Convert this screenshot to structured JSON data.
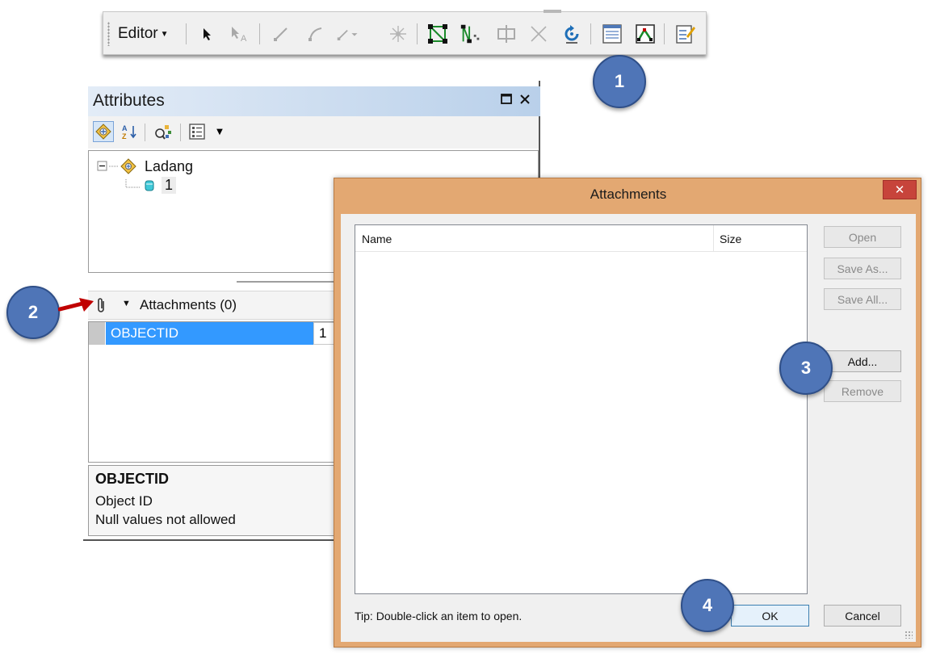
{
  "toolbar": {
    "editor_label": "Editor",
    "tools": [
      "edit-tool-icon",
      "edit-annotation-icon",
      "straight-segment-icon",
      "end-point-arc-icon",
      "trace-icon",
      "point-icon",
      "edit-vertices-icon",
      "reshape-feature-icon",
      "cut-polygons-icon",
      "split-icon",
      "rotate-icon",
      "attributes-icon",
      "sketch-properties-icon",
      "create-features-icon"
    ]
  },
  "attributes": {
    "title": "Attributes",
    "tree": {
      "layer": "Ladang",
      "feature": "1"
    },
    "attachments_label": "Attachments (0)",
    "grid": {
      "field": "OBJECTID",
      "value": "1"
    },
    "description": {
      "heading": "OBJECTID",
      "line1": "Object ID",
      "line2": "Null values not allowed"
    }
  },
  "dialog": {
    "title": "Attachments",
    "columns": [
      "Name",
      "Size"
    ],
    "buttons": {
      "open": "Open",
      "save_as": "Save As...",
      "save_all": "Save All...",
      "add": "Add...",
      "remove": "Remove",
      "ok": "OK",
      "cancel": "Cancel"
    },
    "tip": "Tip:  Double-click an item to open."
  },
  "callouts": [
    "1",
    "2",
    "3",
    "4"
  ],
  "colors": {
    "dialog_frame": "#e3a872",
    "close_button": "#c7443b",
    "callout": "#4f75b7",
    "selection": "#3399ff",
    "arrow": "#c00000"
  }
}
